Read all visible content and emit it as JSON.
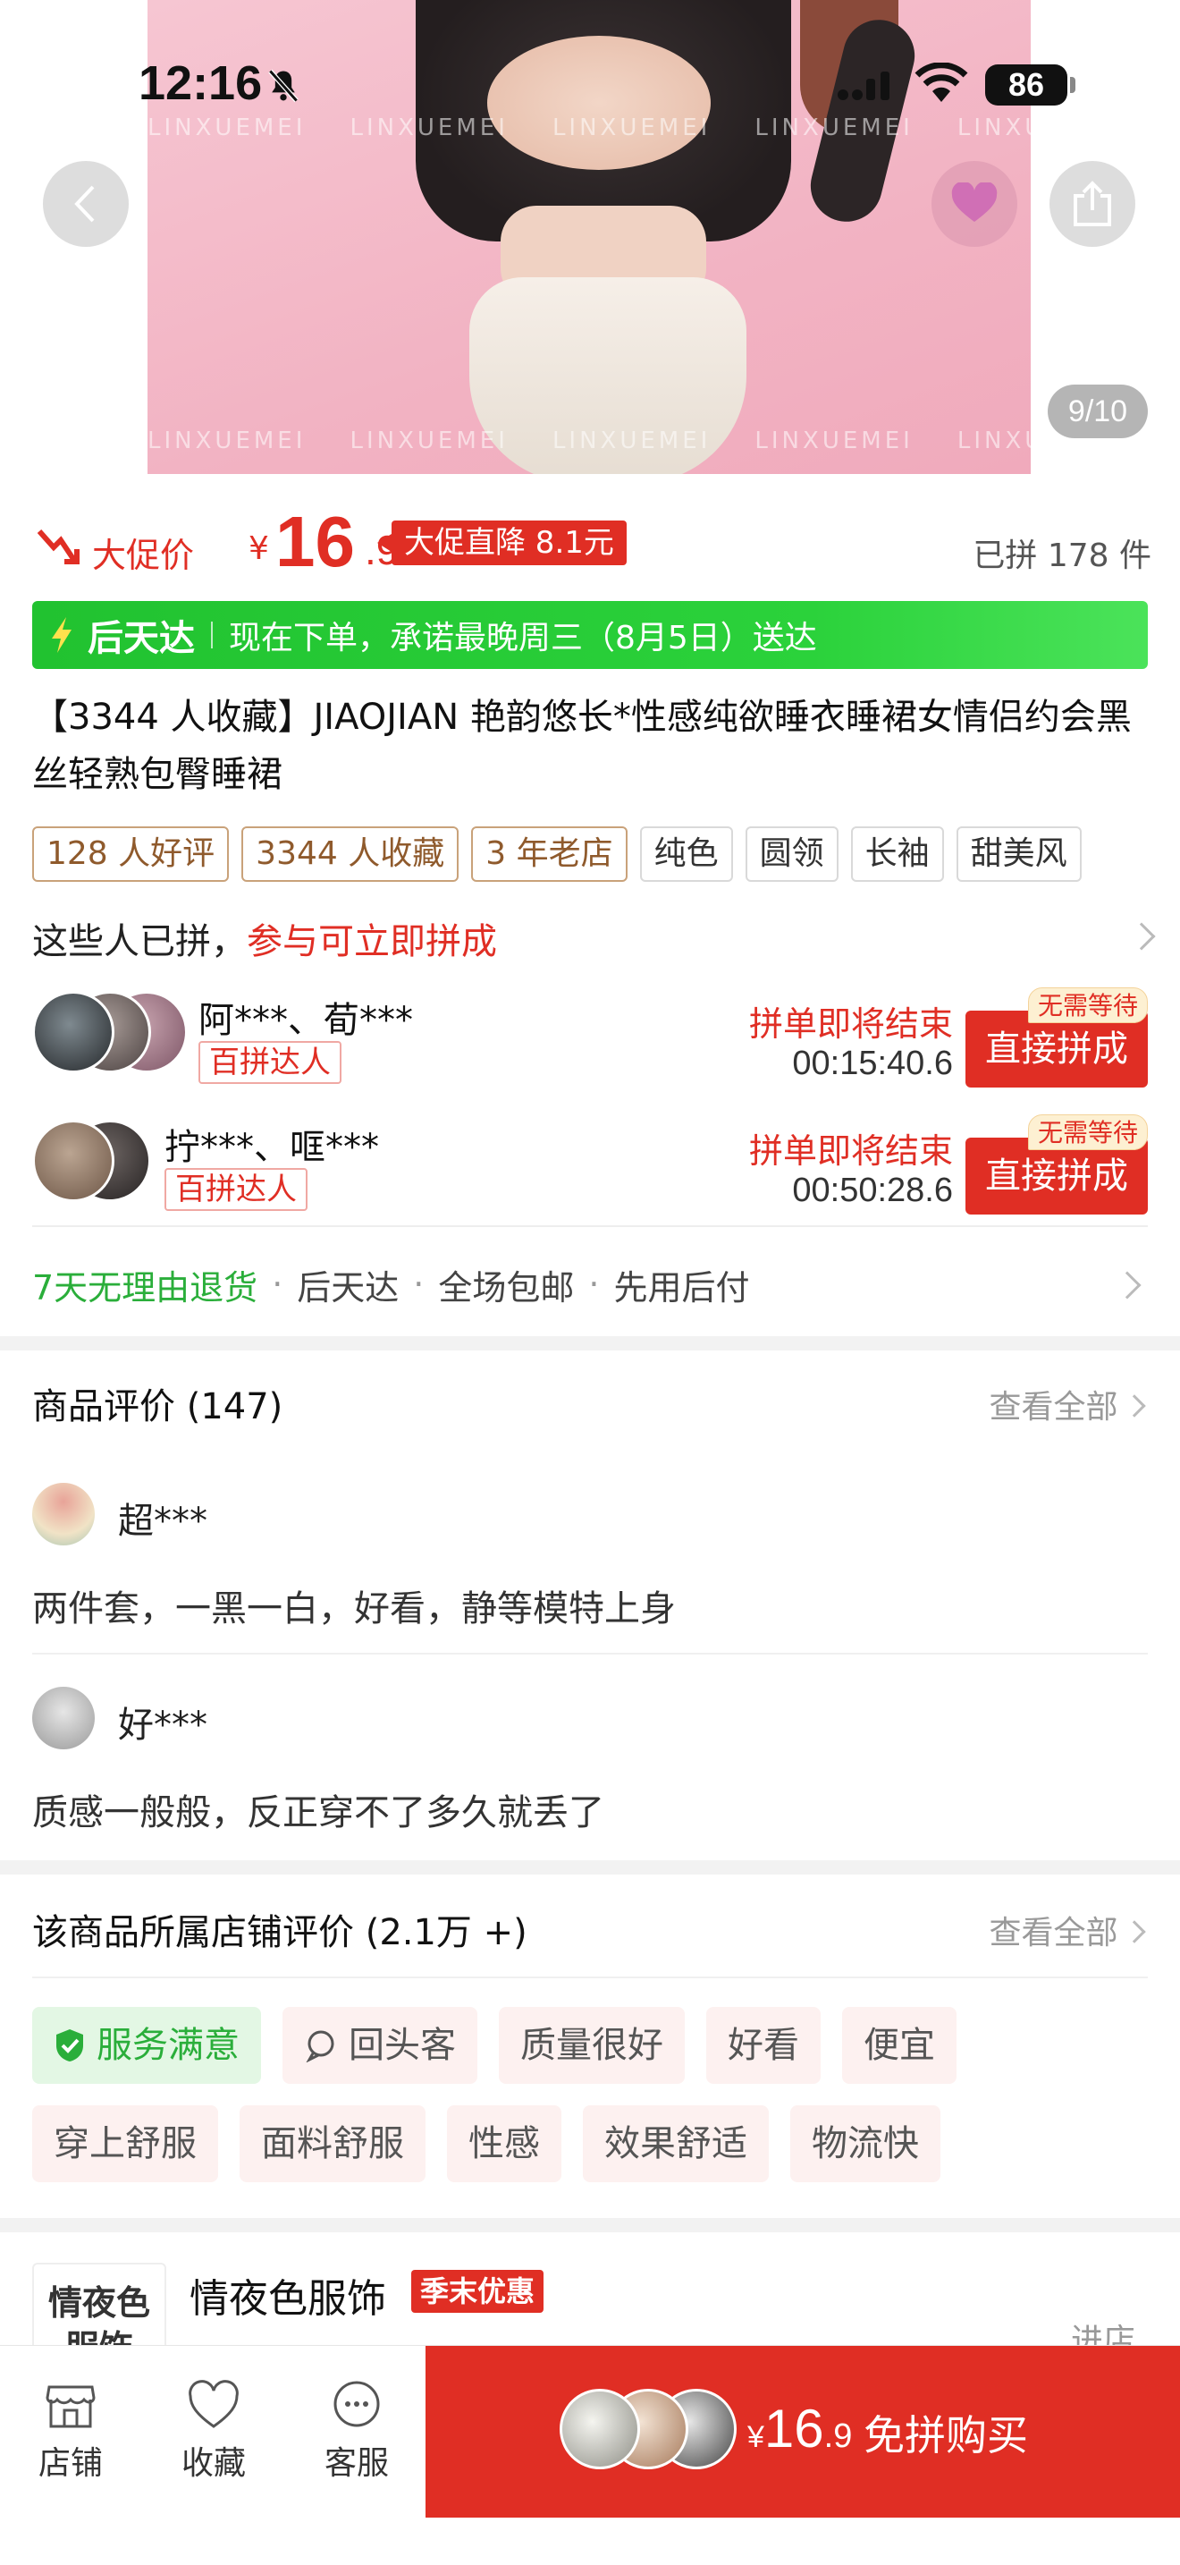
{
  "status_bar": {
    "time": "12:16",
    "battery": "86"
  },
  "gallery": {
    "counter": "9/10",
    "watermark": "LINXUEMEI"
  },
  "price": {
    "promo_label": "大促价",
    "currency": "¥",
    "integer": "16",
    "decimal": ".9",
    "drop_badge": "大促直降 8.1元",
    "sold": "已拼 178 件"
  },
  "delivery": {
    "brand": "后天达",
    "text": "现在下单，承诺最晚周三（8月5日）送达"
  },
  "product": {
    "title": "【3344 人收藏】JIAOJIAN 艳韵悠长*性感纯欲睡衣睡裙女情侣约会黑丝轻熟包臀睡裙"
  },
  "tags": [
    "128 人好评",
    "3344 人收藏",
    "3 年老店",
    "纯色",
    "圆领",
    "长袖",
    "甜美风"
  ],
  "group": {
    "head": "这些人已拼，",
    "head_red": "参与可立即拼成",
    "rows": [
      {
        "names": "阿***、荀***",
        "badge": "百拼达人",
        "ending": "拼单即将结束",
        "countdown": "00:15:40.6",
        "button": "直接拼成",
        "nowait": "无需等待"
      },
      {
        "names": "拧***、哐***",
        "badge": "百拼达人",
        "ending": "拼单即将结束",
        "countdown": "00:50:28.6",
        "button": "直接拼成",
        "nowait": "无需等待"
      }
    ]
  },
  "guarantees": {
    "return": "7天无理由退货",
    "items": [
      "后天达",
      "全场包邮",
      "先用后付"
    ]
  },
  "reviews": {
    "title": "商品评价 (147)",
    "see_all": "查看全部",
    "items": [
      {
        "name": "超***",
        "text": "两件套，一黑一白，好看，静等模特上身"
      },
      {
        "name": "好***",
        "text": "质感一般般，反正穿不了多久就丢了"
      }
    ]
  },
  "store_reviews": {
    "title": "该商品所属店铺评价 (2.1万 +)",
    "see_all": "查看全部",
    "chips": [
      "服务满意",
      "回头客",
      "质量很好",
      "好看",
      "便宜",
      "穿上舒服",
      "面料舒服",
      "性感",
      "效果舒适",
      "物流快"
    ]
  },
  "shop": {
    "logo_text": "情夜色服饰",
    "name": "情夜色服饰",
    "tag": "季末优惠",
    "enter": "进店"
  },
  "bottom_nav": {
    "items": [
      "店铺",
      "收藏",
      "客服"
    ],
    "buy_currency": "¥",
    "buy_integer": "16",
    "buy_decimal": ".9",
    "buy_label": "免拼购买"
  },
  "colors": {
    "accent": "#e02e24",
    "green": "#2aae3a",
    "delivery_green": "#22c232"
  }
}
